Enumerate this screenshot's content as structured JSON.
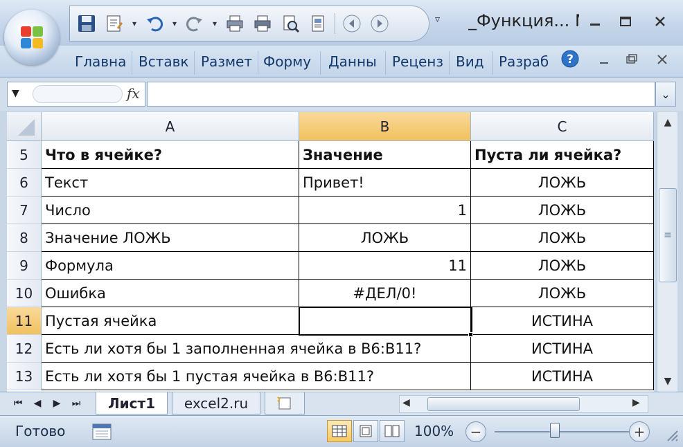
{
  "window": {
    "title": "_Функция... М"
  },
  "ribbon": {
    "tabs": [
      "Главна",
      "Вставк",
      "Размет",
      "Форму",
      "Данны",
      "Реценз",
      "Вид",
      "Разраб"
    ]
  },
  "formula_bar": {
    "fx_label": "fx",
    "value": ""
  },
  "grid": {
    "columns": [
      "A",
      "B",
      "C"
    ],
    "rows": [
      {
        "num": "5",
        "a": "Что в ячейке?",
        "b": "Значение",
        "c": "Пуста ли ячейка?"
      },
      {
        "num": "6",
        "a": "Текст",
        "b": "Привет!",
        "c": "ЛОЖЬ"
      },
      {
        "num": "7",
        "a": "Число",
        "b": "1",
        "c": "ЛОЖЬ"
      },
      {
        "num": "8",
        "a": "Значение ЛОЖЬ",
        "b": "ЛОЖЬ",
        "c": "ЛОЖЬ"
      },
      {
        "num": "9",
        "a": "Формула",
        "b": "11",
        "c": "ЛОЖЬ"
      },
      {
        "num": "10",
        "a": "Ошибка",
        "b": "#ДЕЛ/0!",
        "c": "ЛОЖЬ"
      },
      {
        "num": "11",
        "a": "Пустая ячейка",
        "b": "",
        "c": "ИСТИНА"
      },
      {
        "num": "12",
        "a": "Есть ли хотя бы 1 заполненная ячейка в B6:B11?",
        "b": "",
        "c": "ИСТИНА"
      },
      {
        "num": "13",
        "a": "Есть ли хотя бы 1 пустая ячейка в B6:B11?",
        "b": "",
        "c": "ИСТИНА"
      }
    ],
    "active_cell": "B11"
  },
  "sheets": {
    "tabs": [
      "Лист1",
      "excel2.ru"
    ],
    "active": "Лист1"
  },
  "statusbar": {
    "status": "Готово",
    "zoom": "100%"
  },
  "colors": {
    "header_active": "#f1c15f",
    "grid_border": "#000000",
    "ribbon_text": "#15386b"
  }
}
